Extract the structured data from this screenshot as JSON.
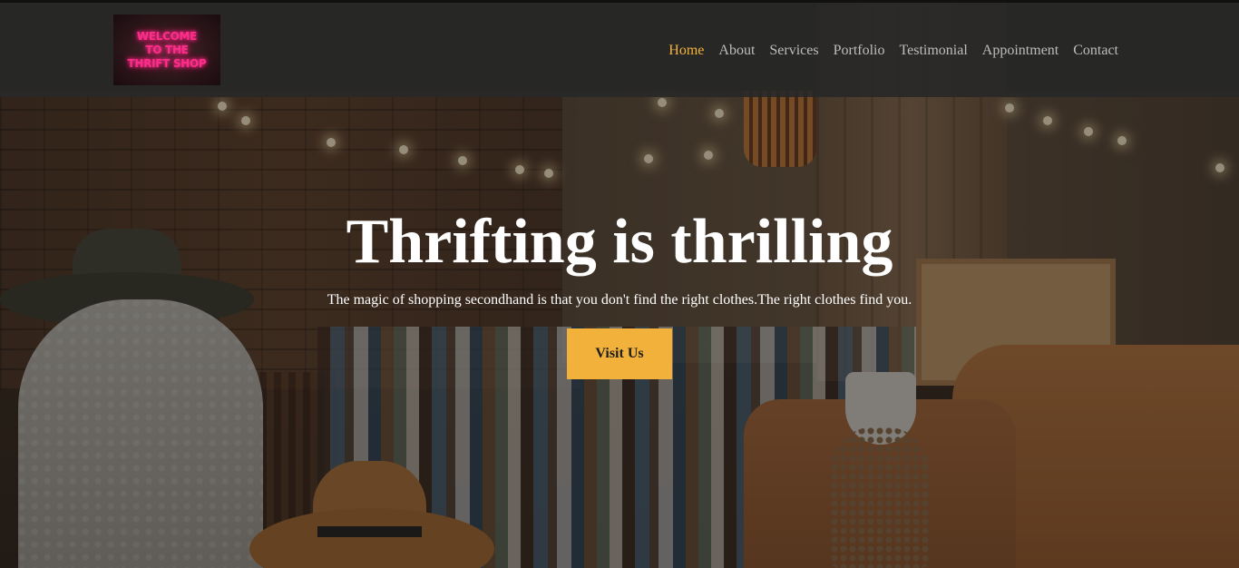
{
  "logo": {
    "lines": [
      "WELCOME",
      "TO THE",
      "THRIFT SHOP"
    ]
  },
  "nav": {
    "items": [
      {
        "label": "Home",
        "active": true
      },
      {
        "label": "About"
      },
      {
        "label": "Services"
      },
      {
        "label": "Portfolio"
      },
      {
        "label": "Testimonial"
      },
      {
        "label": "Appointment"
      },
      {
        "label": "Contact"
      }
    ]
  },
  "hero": {
    "title": "Thrifting is thrilling",
    "subtitle": "The magic of shopping secondhand is that you don't find the right clothes.The right clothes find you.",
    "cta_label": "Visit Us"
  },
  "colors": {
    "accent": "#f2b13a",
    "nav_active": "#f4b33d",
    "nav_text": "#bdbdbd",
    "header_bg": "#282828",
    "logo_neon": "#ff2d8a"
  }
}
